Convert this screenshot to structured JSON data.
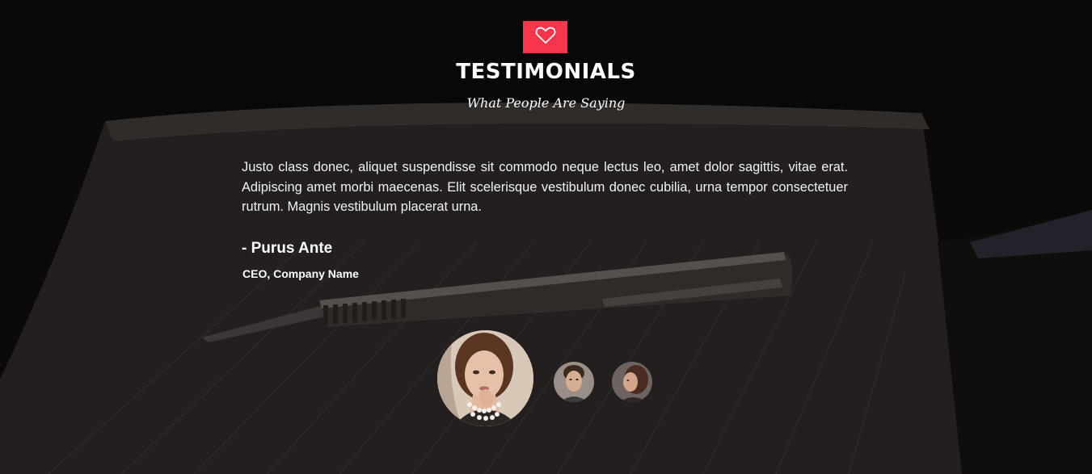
{
  "section": {
    "icon": "heart-icon",
    "accent_color": "#f5364b",
    "title": "TESTIMONIALS",
    "subtitle": "What People Are Saying"
  },
  "testimonial": {
    "quote": "Justo class donec, aliquet suspendisse sit commodo neque lectus leo, amet dolor sagittis, vitae erat. Adipiscing amet morbi maecenas. Elit scelerisque vestibulum donec cubilia, urna tempor consectetuer rutrum. Magnis vestibulum placerat urna.",
    "author": "- Purus Ante",
    "role": "CEO, Company Name"
  },
  "avatars": [
    {
      "name": "avatar-woman-pearls",
      "active": true
    },
    {
      "name": "avatar-man",
      "active": false
    },
    {
      "name": "avatar-woman-profile",
      "active": false
    }
  ]
}
